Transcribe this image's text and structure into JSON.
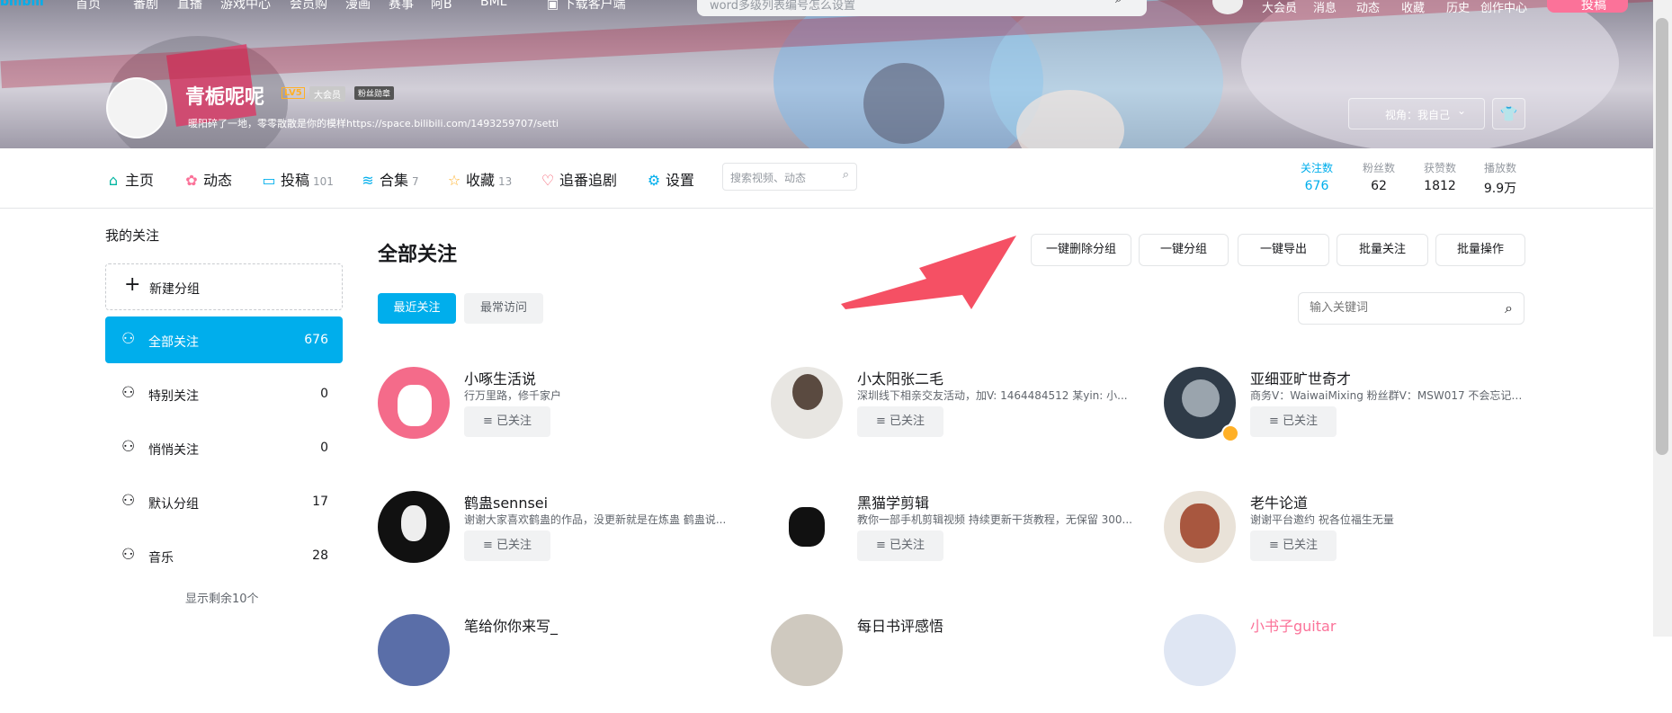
{
  "topnav": {
    "logo": "bilibili",
    "items": [
      "首页",
      "番剧",
      "直播",
      "游戏中心",
      "会员购",
      "漫画",
      "赛事",
      "阿B",
      "BML"
    ],
    "download": "下载客户端",
    "search_placeholder": "word多级列表编号怎么设置",
    "right": [
      "大会员",
      "消息",
      "动态",
      "收藏",
      "历史",
      "创作中心"
    ],
    "upload": "投稿"
  },
  "profile": {
    "username": "青栀呢呢",
    "level": "LV5",
    "vip": "大会员",
    "fan_badge": "粉丝勋章",
    "sign": "暖阳碎了一地，零零散散是你的模样https://space.bilibili.com/1493259707/setti",
    "view_label": "视角：我自己"
  },
  "tabs": [
    {
      "label": "主页",
      "count": ""
    },
    {
      "label": "动态",
      "count": ""
    },
    {
      "label": "投稿",
      "count": "101"
    },
    {
      "label": "合集",
      "count": "7"
    },
    {
      "label": "收藏",
      "count": "13"
    },
    {
      "label": "追番追剧",
      "count": ""
    },
    {
      "label": "设置",
      "count": ""
    }
  ],
  "space_search_placeholder": "搜索视频、动态",
  "stats": [
    {
      "k": "关注数",
      "v": "676"
    },
    {
      "k": "粉丝数",
      "v": "62"
    },
    {
      "k": "获赞数",
      "v": "1812"
    },
    {
      "k": "播放数",
      "v": "9.9万"
    }
  ],
  "sidebar": {
    "title": "我的关注",
    "new_group": "新建分组",
    "items": [
      {
        "label": "全部关注",
        "count": "676"
      },
      {
        "label": "特别关注",
        "count": "0"
      },
      {
        "label": "悄悄关注",
        "count": "0"
      },
      {
        "label": "默认分组",
        "count": "17"
      },
      {
        "label": "音乐",
        "count": "28"
      }
    ],
    "show_more": "显示剩余10个"
  },
  "main": {
    "title": "全部关注",
    "actions": [
      "一键删除分组",
      "一键分组",
      "一键导出",
      "批量关注",
      "批量操作"
    ],
    "tab_recent": "最近关注",
    "tab_frequent": "最常访问",
    "keyword_placeholder": "输入关键词",
    "followed_label": "已关注",
    "cards": [
      {
        "name": "小啄生活说",
        "desc": "行万里路，修千家户"
      },
      {
        "name": "小太阳张二毛",
        "desc": "深圳线下相亲交友活动，加V: 1464484512 某yin: 小..."
      },
      {
        "name": "亚细亚旷世奇才",
        "desc": "商务V：WaiwaiMixing 粉丝群V：MSW017 不会忘记每..."
      },
      {
        "name": "鹤蛊sennsei",
        "desc": "谢谢大家喜欢鹤蛊的作品，没更新就是在炼蛊 鹤蛊说..."
      },
      {
        "name": "黑猫学剪辑",
        "desc": "教你一部手机剪辑视频 持续更新干货教程，无保留 300..."
      },
      {
        "name": "老牛论道",
        "desc": "谢谢平台邀约 祝各位福生无量"
      },
      {
        "name": "笔给你你来写_",
        "desc": ""
      },
      {
        "name": "每日书评感悟",
        "desc": ""
      },
      {
        "name": "小书子guitar",
        "desc": ""
      }
    ]
  },
  "colors": {
    "accent": "#00aeec",
    "pink": "#fb7299",
    "arrow": "#f55064"
  }
}
